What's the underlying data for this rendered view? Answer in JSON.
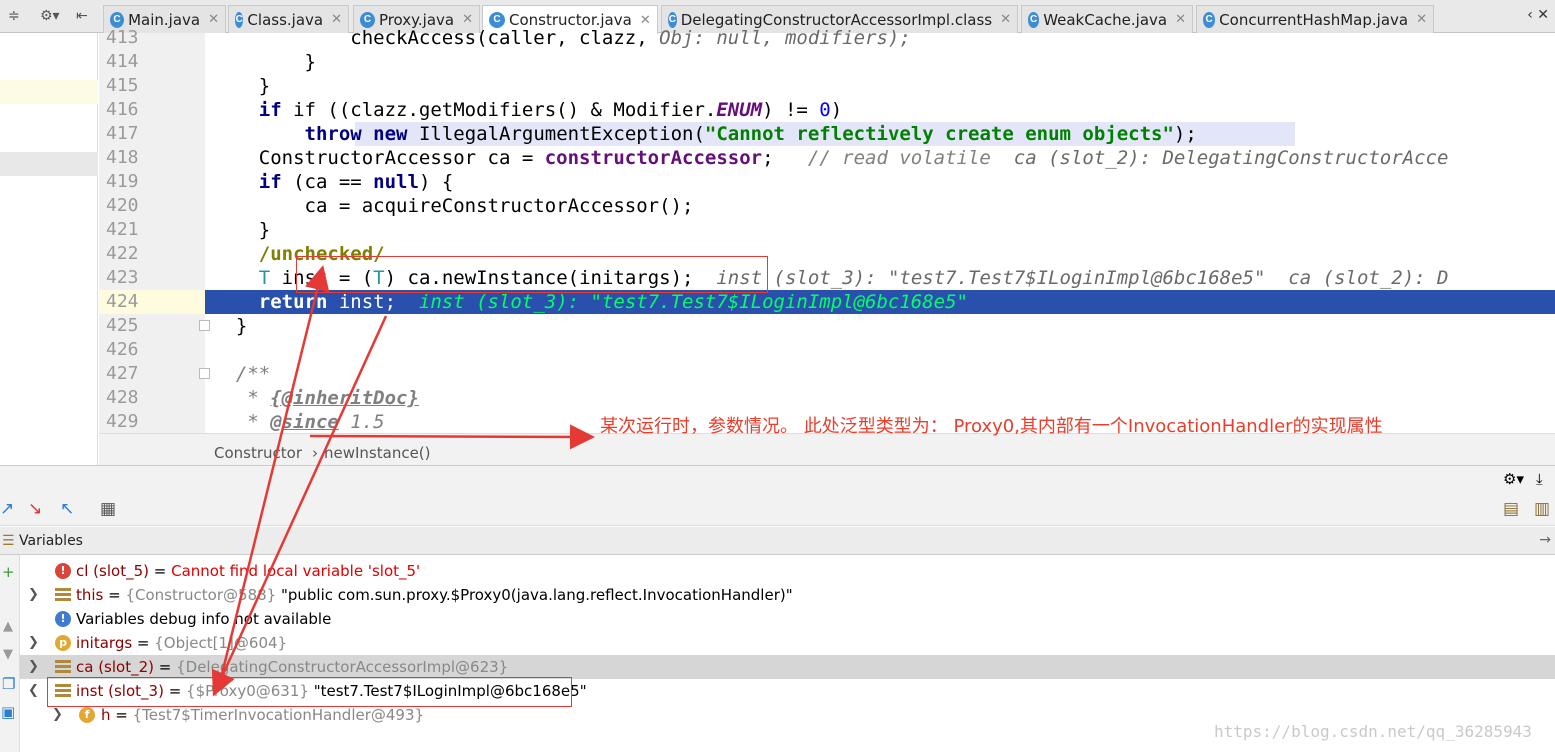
{
  "tabs": [
    {
      "label": "Main.java",
      "active": false
    },
    {
      "label": "Class.java",
      "active": false
    },
    {
      "label": "Proxy.java",
      "active": false
    },
    {
      "label": "Constructor.java",
      "active": true
    },
    {
      "label": "DelegatingConstructorAccessorImpl.class",
      "active": false
    },
    {
      "label": "WeakCache.java",
      "active": false
    },
    {
      "label": "ConcurrentHashMap.java",
      "active": false
    }
  ],
  "tab_overflow": "‹",
  "line_numbers": [
    "413",
    "414",
    "415",
    "416",
    "417",
    "418",
    "419",
    "420",
    "421",
    "422",
    "423",
    "424",
    "425",
    "426",
    "427",
    "428",
    "429"
  ],
  "code": {
    "l413_a": "            checkAccess(caller, clazz, ",
    "l413_b": "Obj: null, modifiers);",
    "l414": "        }",
    "l415": "    }",
    "l416_a": "    if ((clazz.getModifiers() & Modifier.",
    "l416_enum": "ENUM",
    "l416_b": ") != ",
    "l416_num": "0",
    "l416_c": ")",
    "l417_throw": "throw",
    "l417_new": "new",
    "l417_a": " IllegalArgumentException(",
    "l417_str": "\"Cannot reflectively create enum objects\"",
    "l417_b": ");",
    "l418_a": "    ConstructorAccessor ca = ",
    "l418_field": "constructorAccessor",
    "l418_b": ";   ",
    "l418_cmt": "// read volatile",
    "l418_inl": "  ca (slot_2): DelegatingConstructorAcce",
    "l419_if": "if",
    "l419_a": " (ca == ",
    "l419_null": "null",
    "l419_b": ") {",
    "l420": "        ca = acquireConstructorAccessor();",
    "l421": "    }",
    "l422": "/unchecked/",
    "l423_t1": "T",
    "l423_a": " inst = (",
    "l423_t2": "T",
    "l423_b": ") ca.newInstance(initargs);",
    "l423_inl": "  inst (slot_3): \"test7.Test7$ILoginImpl@6bc168e5\"  ca (slot_2): D",
    "l424_kw": "return",
    "l424_a": " inst;",
    "l424_inl": "  inst (slot_3): \"test7.Test7$ILoginImpl@6bc168e5\"",
    "l425": "}",
    "l427": "/**",
    "l428_a": " * ",
    "l428_tag": "{@inheritDoc}",
    "l429_a": " * ",
    "l429_tag": "@since",
    "l429_b": " 1.5"
  },
  "breadcrumb": {
    "class": "Constructor",
    "sep": "›",
    "method": "newInstance()"
  },
  "variables_title": "Variables",
  "variables": [
    {
      "name": "cl (slot_5)",
      "eq": " = ",
      "msg": "Cannot find local variable 'slot_5'"
    },
    {
      "name": "this",
      "eq": " = ",
      "ref": "{Constructor@588}",
      "val": " \"public com.sun.proxy.$Proxy0(java.lang.reflect.InvocationHandler)\""
    },
    {
      "msg": "Variables debug info not available"
    },
    {
      "name": "initargs",
      "eq": " = ",
      "ref": "{Object[1]@604}"
    },
    {
      "name": "ca (slot_2)",
      "eq": " = ",
      "ref": "{DelegatingConstructorAccessorImpl@623}"
    },
    {
      "name": "inst (slot_3)",
      "eq": " = ",
      "ref": "{$Proxy0@631}",
      "val": " \"test7.Test7$ILoginImpl@6bc168e5\""
    },
    {
      "name": "h",
      "eq": " = ",
      "ref": "{Test7$TimerInvocationHandler@493}"
    }
  ],
  "annotation_note": "某次运行时，参数情况。    此处泛型类型为： Proxy0,其内部有一个InvocationHandler的实现属性",
  "watermark": "https://blog.csdn.net/qq_36285943",
  "colors": {
    "accent_line": "#2a50ad",
    "annotation": "#e53935"
  }
}
